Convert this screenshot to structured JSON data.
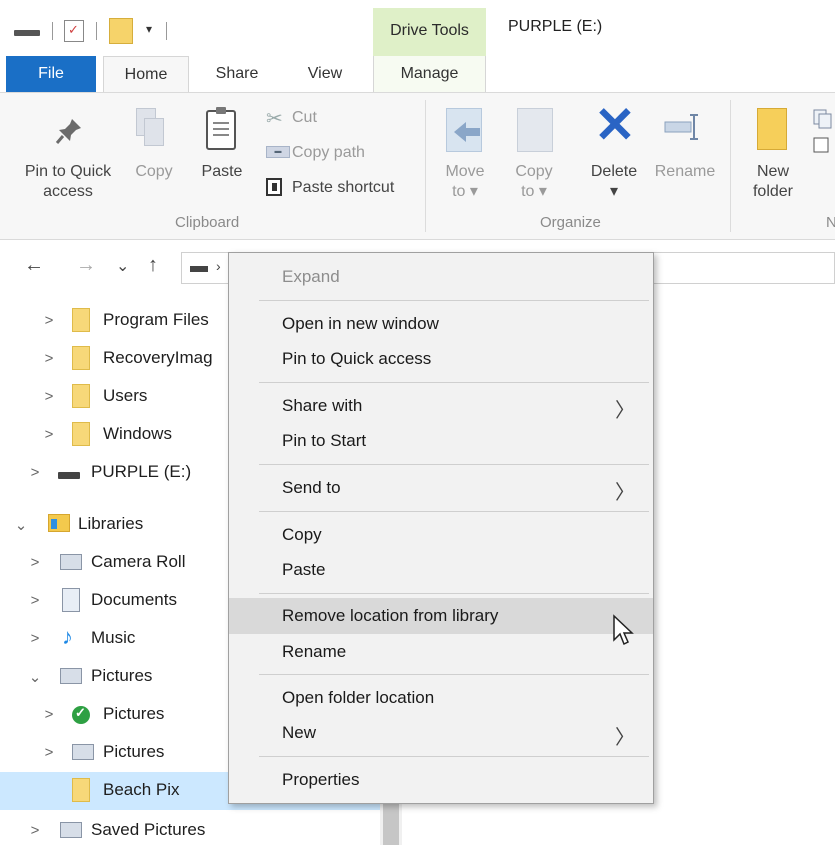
{
  "window": {
    "title": "PURPLE (E:)",
    "contextual_tab_group": "Drive Tools"
  },
  "tabs": {
    "file": "File",
    "home": "Home",
    "share": "Share",
    "view": "View",
    "manage": "Manage"
  },
  "ribbon": {
    "clipboard": {
      "pin_line1": "Pin to Quick",
      "pin_line2": "access",
      "copy": "Copy",
      "paste": "Paste",
      "cut": "Cut",
      "copy_path": "Copy path",
      "paste_shortcut": "Paste shortcut",
      "group_label": "Clipboard"
    },
    "organize": {
      "move_line1": "Move",
      "move_line2": "to ▾",
      "copy_line1": "Copy",
      "copy_line2": "to ▾",
      "delete": "Delete",
      "delete_arrow": "▾",
      "rename": "Rename",
      "group_label": "Organize"
    },
    "new": {
      "new_line1": "New",
      "new_line2": "folder",
      "group_label_partial": "N"
    }
  },
  "nav": {
    "back": "←",
    "forward": "→",
    "recent": "⌄",
    "up": "↑",
    "address_chevron": "›"
  },
  "tree": {
    "items": [
      {
        "label": "Program Files",
        "chevron": ">",
        "icon": "folder-icon"
      },
      {
        "label": "RecoveryImag",
        "chevron": ">",
        "icon": "folder-icon"
      },
      {
        "label": "Users",
        "chevron": ">",
        "icon": "folder-icon"
      },
      {
        "label": "Windows",
        "chevron": ">",
        "icon": "folder-icon"
      },
      {
        "label": "PURPLE (E:)",
        "chevron": ">",
        "icon": "drive-icon"
      },
      {
        "label": "Libraries",
        "chevron": "⌄",
        "icon": "libraries-icon"
      },
      {
        "label": "Camera Roll",
        "chevron": ">",
        "icon": "pictures-library-icon"
      },
      {
        "label": "Documents",
        "chevron": ">",
        "icon": "documents-icon"
      },
      {
        "label": "Music",
        "chevron": ">",
        "icon": "music-icon"
      },
      {
        "label": "Pictures",
        "chevron": "⌄",
        "icon": "pictures-library-icon"
      },
      {
        "label": "Pictures",
        "chevron": ">",
        "icon": "synced-folder-icon"
      },
      {
        "label": "Pictures",
        "chevron": ">",
        "icon": "pictures-library-icon"
      },
      {
        "label": "Beach Pix",
        "chevron": "",
        "icon": "folder-icon"
      },
      {
        "label": "Saved Pictures",
        "chevron": ">",
        "icon": "pictures-library-icon"
      }
    ]
  },
  "context_menu": {
    "expand": "Expand",
    "open_new_window": "Open in new window",
    "pin_quick_access": "Pin to Quick access",
    "share_with": "Share with",
    "pin_to_start": "Pin to Start",
    "send_to": "Send to",
    "copy": "Copy",
    "paste": "Paste",
    "remove_location": "Remove location from library",
    "rename": "Rename",
    "open_folder_location": "Open folder location",
    "new": "New",
    "properties": "Properties",
    "submenu_arrow": "〉"
  },
  "colors": {
    "file_tab": "#1a6fc6",
    "drive_tools": "#dff0c8",
    "delete_icon": "#2a64c4",
    "selection": "#cce8ff"
  }
}
